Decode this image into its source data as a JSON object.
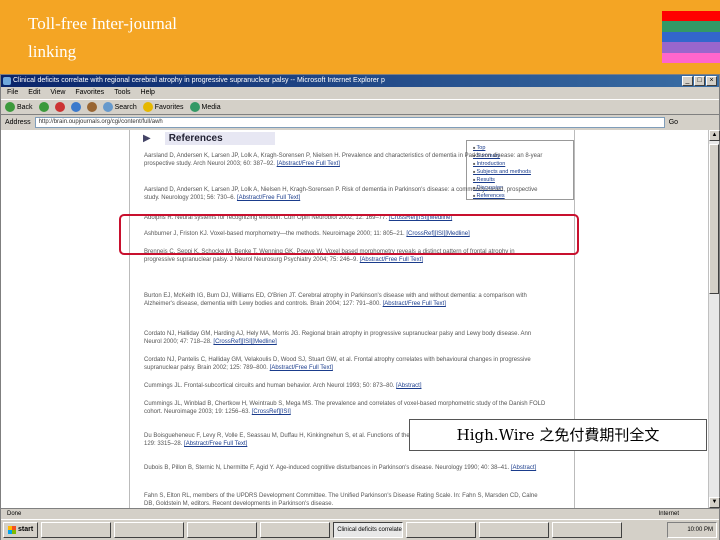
{
  "slide": {
    "title_line1": "Toll-free Inter-journal",
    "title_line2": "linking",
    "header_color": "#f4a524",
    "stripe_colors": [
      "#f4a524",
      "#ff0000",
      "#339966",
      "#3366cc",
      "#9966cc",
      "#ff66cc",
      "#f4a524"
    ]
  },
  "browser": {
    "window_title": "Clinical deficits correlate with regional cerebral atrophy in progressive supranuclear palsy -- Microsoft Internet Explorer p",
    "menu": [
      "File",
      "Edit",
      "View",
      "Favorites",
      "Tools",
      "Help"
    ],
    "toolbar": {
      "back": "Back",
      "forward": "",
      "search": "Search",
      "favorites": "Favorites",
      "media": "Media"
    },
    "address_label": "Address",
    "address_url": "http://brain.oupjournals.org/cgi/content/full/awh",
    "go_label": "Go",
    "status_text": "Done",
    "status_zone": "Internet"
  },
  "references": {
    "heading": "References",
    "nav": [
      "Top",
      "Summary",
      "Introduction",
      "Subjects and methods",
      "Results",
      "Discussion",
      "References"
    ],
    "items": [
      {
        "text": "Aarsland D, Andersen K, Larsen JP, Lolk A, Kragh-Sorensen P, Nielsen H. Prevalence and characteristics of dementia in Parkinson disease: an 8-year prospective study. Arch Neurol 2003; 60: 387–92.",
        "links": "[Abstract/Free Full Text]"
      },
      {
        "text": "Aarsland D, Andersen K, Larsen JP, Lolk A, Nielsen H, Kragh-Sorensen P. Risk of dementia in Parkinson's disease: a community-based, prospective study. Neurology 2001; 56: 730–6.",
        "links": "[Abstract/Free Full Text]"
      },
      {
        "text": "Adolphs R. Neural systems for recognizing emotion. Curr Opin Neurobiol 2002; 12: 169–77.",
        "links": "[CrossRef][ISI][Medline]"
      },
      {
        "text": "Ashburner J, Friston KJ. Voxel-based morphometry—the methods. Neuroimage 2000; 11: 805–21.",
        "links": "[CrossRef][ISI][Medline]"
      },
      {
        "text": "Brenneis C, Seppi K, Schocke M, Benke T, Wenning GK, Poewe W. Voxel based morphometry reveals a distinct pattern of frontal atrophy in progressive supranuclear palsy. J Neurol Neurosurg Psychiatry 2004; 75: 246–9.",
        "links": "[Abstract/Free Full Text]"
      },
      {
        "text": "Burton EJ, McKeith IG, Burn DJ, Williams ED, O'Brien JT. Cerebral atrophy in Parkinson's disease with and without dementia: a comparison with Alzheimer's disease, dementia with Lewy bodies and controls. Brain 2004; 127: 791–800.",
        "links": "[Abstract/Free Full Text]"
      },
      {
        "text": "Cordato NJ, Halliday GM, Harding AJ, Hely MA, Morris JG. Regional brain atrophy in progressive supranuclear palsy and Lewy body disease. Ann Neurol 2000; 47: 718–28.",
        "links": "[CrossRef][ISI][Medline]"
      },
      {
        "text": "Cordato NJ, Pantelis C, Halliday GM, Velakoulis D, Wood SJ, Stuart GW, et al. Frontal atrophy correlates with behavioural changes in progressive supranuclear palsy. Brain 2002; 125: 789–800.",
        "links": "[Abstract/Free Full Text]"
      },
      {
        "text": "Cummings JL. Frontal-subcortical circuits and human behavior. Arch Neurol 1993; 50: 873–80.",
        "links": "[Abstract]"
      },
      {
        "text": "Cummings JL, Winblad B, Chertkow H, Weintraub S, Mega MS. The prevalence and correlates of voxel-based morphometric study of the Danish FOLD cohort. Neuroimage 2003; 19: 1256–63.",
        "links": "[CrossRef][ISI]"
      },
      {
        "text": "Du Boisgueheneuc F, Levy R, Volle E, Seassau M, Duffau H, Kinkingnehun S, et al. Functions of the left superior frontal gyrus in humans. Brain 2006; 129: 3315–28.",
        "links": "[Abstract/Free Full Text]"
      },
      {
        "text": "Dubois B, Pillon B, Sternic N, Lhermitte F, Agid Y. Age-induced cognitive disturbances in Parkinson's disease. Neurology 1990; 40: 38–41.",
        "links": "[Abstract]"
      },
      {
        "text": "Fahn S, Elton RL, members of the UPDRS Development Committee. The Unified Parkinson's Disease Rating Scale. In: Fahn S, Marsden CD, Calne DB, Goldstein M, editors. Recent developments in Parkinson's disease.",
        "links": ""
      }
    ]
  },
  "callout": "High.Wire 之免付費期刊全文",
  "taskbar": {
    "start_label": "start",
    "tasks": [
      "",
      "",
      "",
      "",
      "Clinical deficits correlate...",
      "",
      "",
      ""
    ],
    "tray_text": "10:00 PM"
  }
}
